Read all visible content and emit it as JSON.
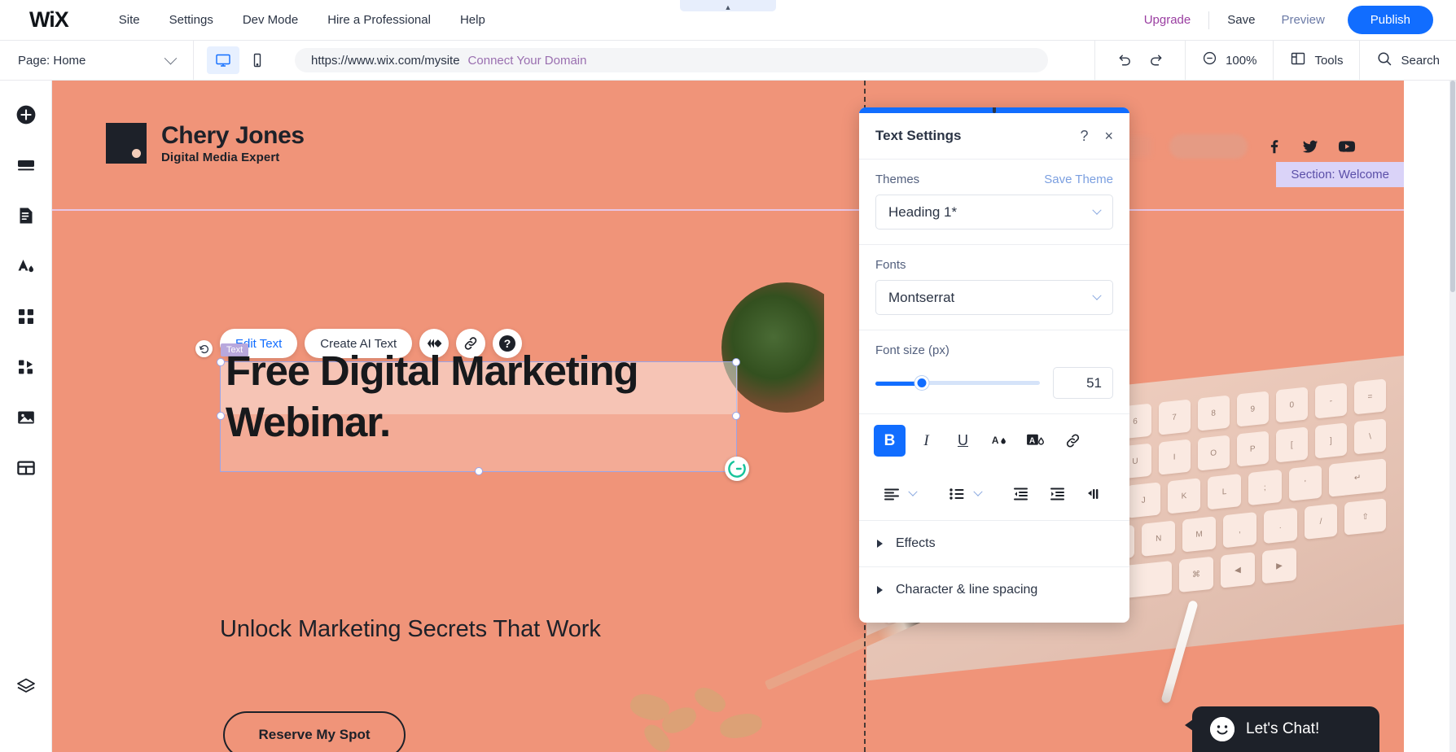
{
  "topbar": {
    "logo": "WiX",
    "menu": [
      {
        "label": "Site"
      },
      {
        "label": "Settings"
      },
      {
        "label": "Dev Mode"
      },
      {
        "label": "Hire a Professional"
      },
      {
        "label": "Help"
      }
    ],
    "upgrade_label": "Upgrade",
    "save_label": "Save",
    "preview_label": "Preview",
    "publish_label": "Publish"
  },
  "toolbar": {
    "page_label": "Page: Home",
    "url": "https://www.wix.com/mysite",
    "connect_domain": "Connect Your Domain",
    "zoom_level": "100%",
    "tools_label": "Tools",
    "search_label": "Search"
  },
  "sidebar": {
    "items": [
      {
        "name": "add-elements",
        "icon": "plus-circle-icon"
      },
      {
        "name": "add-section",
        "icon": "section-icon"
      },
      {
        "name": "pages-menu",
        "icon": "pages-icon"
      },
      {
        "name": "site-design",
        "icon": "theme-paint-icon"
      },
      {
        "name": "apps",
        "icon": "apps-grid-icon"
      },
      {
        "name": "business-tools",
        "icon": "puzzle-icon"
      },
      {
        "name": "media",
        "icon": "image-icon"
      },
      {
        "name": "content-manager",
        "icon": "table-icon"
      }
    ],
    "bottom": {
      "name": "layers",
      "icon": "layers-icon"
    }
  },
  "site": {
    "brand_name": "Chery Jones",
    "brand_tagline": "Digital Media Expert",
    "section_badge": "Section: Welcome",
    "heading": "Free Digital Marketing\nWebinar.",
    "heading_tag": "Text",
    "subheading": "Unlock Marketing Secrets That Work",
    "cta_label": "Reserve My Spot",
    "social": [
      "facebook-icon",
      "twitter-icon",
      "youtube-icon"
    ],
    "background_color": "#f09479"
  },
  "float_toolbar": {
    "edit_text": "Edit Text",
    "create_ai_text": "Create AI Text",
    "icons": [
      "animation-icon",
      "link-icon",
      "help-icon"
    ]
  },
  "panel": {
    "title": "Text Settings",
    "help_icon": "?",
    "close_icon": "×",
    "themes_label": "Themes",
    "save_theme_label": "Save Theme",
    "theme_value": "Heading 1*",
    "fonts_label": "Fonts",
    "font_value": "Montserrat",
    "font_size_label": "Font size (px)",
    "font_size_value": "51",
    "font_size_percent": 28,
    "format_buttons": [
      {
        "name": "bold-button",
        "glyph": "B",
        "active": true
      },
      {
        "name": "italic-button",
        "glyph": "I",
        "active": false
      },
      {
        "name": "underline-button",
        "glyph": "U",
        "active": false
      },
      {
        "name": "text-color-button",
        "glyph": "A",
        "active": false
      },
      {
        "name": "text-highlight-button",
        "glyph": "A",
        "active": false
      },
      {
        "name": "link-button",
        "glyph": "link",
        "active": false
      }
    ],
    "align_buttons": [
      {
        "name": "text-align-button"
      },
      {
        "name": "list-style-button"
      },
      {
        "name": "decrease-indent-button"
      },
      {
        "name": "increase-indent-button"
      },
      {
        "name": "text-direction-button"
      }
    ],
    "effects_label": "Effects",
    "spacing_label": "Character & line spacing",
    "accent_color": "#116dff"
  },
  "chat": {
    "label": "Let's Chat!",
    "icon": "smiley-icon"
  }
}
